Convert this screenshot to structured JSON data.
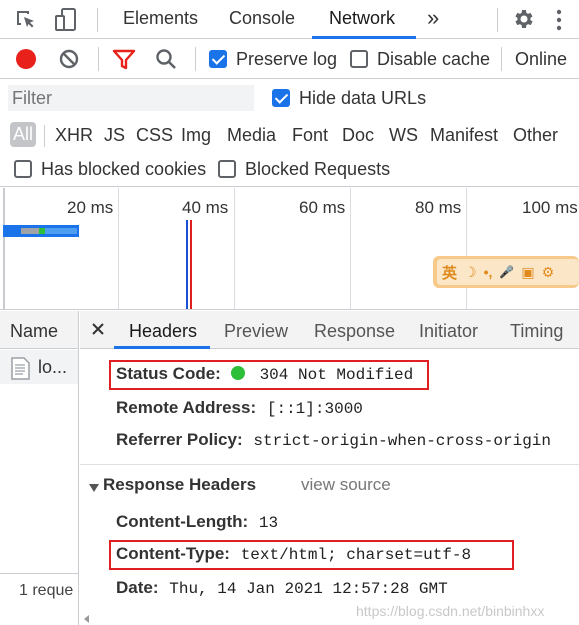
{
  "tabs": {
    "elements": "Elements",
    "console": "Console",
    "network": "Network",
    "more": "»"
  },
  "toolbar": {
    "preserve_log": "Preserve log",
    "disable_cache": "Disable cache",
    "throttling": "Online"
  },
  "filter": {
    "placeholder": "Filter",
    "hide_data_urls": "Hide data URLs"
  },
  "types": [
    "All",
    "XHR",
    "JS",
    "CSS",
    "Img",
    "Media",
    "Font",
    "Doc",
    "WS",
    "Manifest",
    "Other"
  ],
  "blocked": {
    "has_blocked_cookies": "Has blocked cookies",
    "blocked_requests": "Blocked Requests"
  },
  "timeline": {
    "ticks": [
      "20 ms",
      "40 ms",
      "60 ms",
      "80 ms",
      "100 ms"
    ]
  },
  "ime": {
    "items": [
      "英",
      "☽",
      "•,",
      "🎤",
      "▣",
      "⚙"
    ]
  },
  "requests": {
    "header": "Name",
    "items": [
      "lo..."
    ],
    "footer": "1 reque"
  },
  "detail_tabs": [
    "Headers",
    "Preview",
    "Response",
    "Initiator",
    "Timing"
  ],
  "general": {
    "status_code_label": "Status Code:",
    "status_code_value": "304 Not Modified",
    "remote_address_label": "Remote Address:",
    "remote_address_value": "[::1]:3000",
    "referrer_policy_label": "Referrer Policy:",
    "referrer_policy_value": "strict-origin-when-cross-origin"
  },
  "response_headers": {
    "title": "Response Headers",
    "view_source": "view source",
    "content_length_label": "Content-Length:",
    "content_length_value": "13",
    "content_type_label": "Content-Type:",
    "content_type_value": "text/html; charset=utf-8",
    "date_label": "Date:",
    "date_value": "Thu, 14 Jan 2021 12:57:28 GMT"
  },
  "watermark": "https://blog.csdn.net/binbinhxx",
  "colors": {
    "accent": "#1a73e8",
    "record": "#e8221b",
    "status_ok": "#2dbe3a",
    "highlight_box": "#e02020"
  }
}
